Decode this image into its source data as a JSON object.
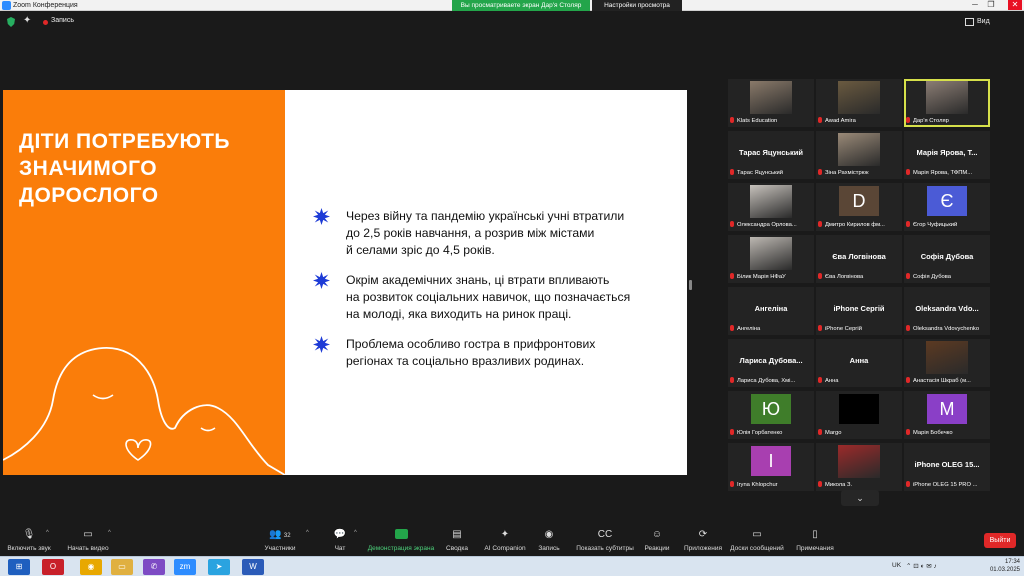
{
  "window": {
    "title": "Zoom Конференция",
    "sharing_banner": "Вы просматриваете экран Дар'я Столяр",
    "view_options": "Настройки просмотра",
    "minimize": "─",
    "maximize": "❐",
    "close": "✕"
  },
  "meeting_bar": {
    "record_label": "Запись",
    "view_label": "Вид"
  },
  "slide": {
    "heading": [
      "ДІТИ ПОТРЕБУЮТЬ",
      "ЗНАЧИМОГО",
      "ДОРОСЛОГО"
    ],
    "bullets": [
      [
        "Через війну та пандемію українські учні втратили",
        "до 2,5 років навчання, а розрив між містами",
        "й селами зріс до 4,5 років."
      ],
      [
        "Окрім академічних знань, ці втрати впливають",
        "на розвиток соціальних навичок, що позначається",
        "на молоді, яка виходить на ринок праці."
      ],
      [
        "Проблема особливо гостра в прифронтових",
        "регіонах та соціально вразливих родинах."
      ]
    ],
    "colors": {
      "orange": "#fa7d0a",
      "star": "#1d3bd6"
    }
  },
  "participants": [
    {
      "center": "",
      "caption": "Klats Education",
      "kind": "photo",
      "photo_color": "#8a7a6a"
    },
    {
      "center": "",
      "caption": "Awad Amira",
      "kind": "photo",
      "photo_color": "#6a5a40"
    },
    {
      "center": "",
      "caption": "Дар'я Столяр",
      "kind": "photo",
      "photo_color": "#8b7d74",
      "active": true
    },
    {
      "center": "Тарас Яцунський",
      "caption": "Тарас Яцунський",
      "kind": "name"
    },
    {
      "center": "",
      "caption": "Зіна Рахмістрюк",
      "kind": "photo",
      "photo_color": "#9a8a78"
    },
    {
      "center": "Марія Ярова, Т...",
      "caption": "Марія Ярова, ТФПМ...",
      "kind": "name"
    },
    {
      "center": "",
      "caption": "Олександра Орлова...",
      "kind": "photo",
      "photo_color": "#c7c2bc"
    },
    {
      "center": "",
      "caption": "Дмитро Кирилов фм...",
      "kind": "letter",
      "letter": "D",
      "letter_bg": "#5a4636"
    },
    {
      "center": "",
      "caption": "Єгор Чуфицький",
      "kind": "letter",
      "letter": "Є",
      "letter_bg": "#4b5bd6"
    },
    {
      "center": "",
      "caption": "Білик Марія НФаУ",
      "kind": "photo",
      "photo_color": "#bdb8b2"
    },
    {
      "center": "Єва Логвінова",
      "caption": "Єва Логвінова",
      "kind": "name"
    },
    {
      "center": "Софія Дубова",
      "caption": "Софія Дубова",
      "kind": "name"
    },
    {
      "center": "Ангеліна",
      "caption": "Ангеліна",
      "kind": "name"
    },
    {
      "center": "iPhone Сергій",
      "caption": "iPhone Сергій",
      "kind": "name"
    },
    {
      "center": "Oleksandra  Vdo...",
      "caption": "Oleksandra Vdovychenko",
      "kind": "name"
    },
    {
      "center": "Лариса  Дубова...",
      "caption": "Лариса Дубова, Хмі...",
      "kind": "name"
    },
    {
      "center": "Анна",
      "caption": "Анна",
      "kind": "name"
    },
    {
      "center": "",
      "caption": "Анастасія Шкраб (м...",
      "kind": "photo",
      "photo_color": "#5c3a22"
    },
    {
      "center": "",
      "caption": "Юлія Горбатенко",
      "kind": "letter",
      "letter": "Ю",
      "letter_bg": "#3f7d2a"
    },
    {
      "center": "",
      "caption": "Margo",
      "kind": "letter",
      "letter": "",
      "letter_bg": "#000000"
    },
    {
      "center": "",
      "caption": "Марія Бобечко",
      "kind": "letter",
      "letter": "М",
      "letter_bg": "#8a3fc7"
    },
    {
      "center": "",
      "caption": "Iryna Khlopchur",
      "kind": "letter",
      "letter": "I",
      "letter_bg": "#a83fb0"
    },
    {
      "center": "",
      "caption": "Микола З.",
      "kind": "photo",
      "photo_color": "#9c2a2a"
    },
    {
      "center": "iPhone OLEG 15...",
      "caption": "iPhone OLEG 15 PRO ...",
      "kind": "name"
    }
  ],
  "gallery_more": "⌄",
  "toolbar": {
    "items": [
      {
        "label": "Включить звук",
        "icon": "🎙"
      },
      {
        "label": "Начать видео",
        "icon": "▭"
      },
      {
        "label": "Участники",
        "icon": "👥",
        "count": "32"
      },
      {
        "label": "Чат",
        "icon": "💬"
      },
      {
        "label": "Демонстрация экрана",
        "icon": "↑"
      },
      {
        "label": "Сводка",
        "icon": "▤"
      },
      {
        "label": "AI Companion",
        "icon": "✦"
      },
      {
        "label": "Запись",
        "icon": "◉"
      },
      {
        "label": "Показать субтитры",
        "icon": "CC"
      },
      {
        "label": "Реакции",
        "icon": "☺"
      },
      {
        "label": "Приложения",
        "icon": "⟳"
      },
      {
        "label": "Доски сообщений",
        "icon": "▭"
      },
      {
        "label": "Примечания",
        "icon": "▯"
      }
    ],
    "leave": "Выйти"
  },
  "taskbar": {
    "language": "UK",
    "time": "17:34",
    "date": "01.03.2025"
  }
}
